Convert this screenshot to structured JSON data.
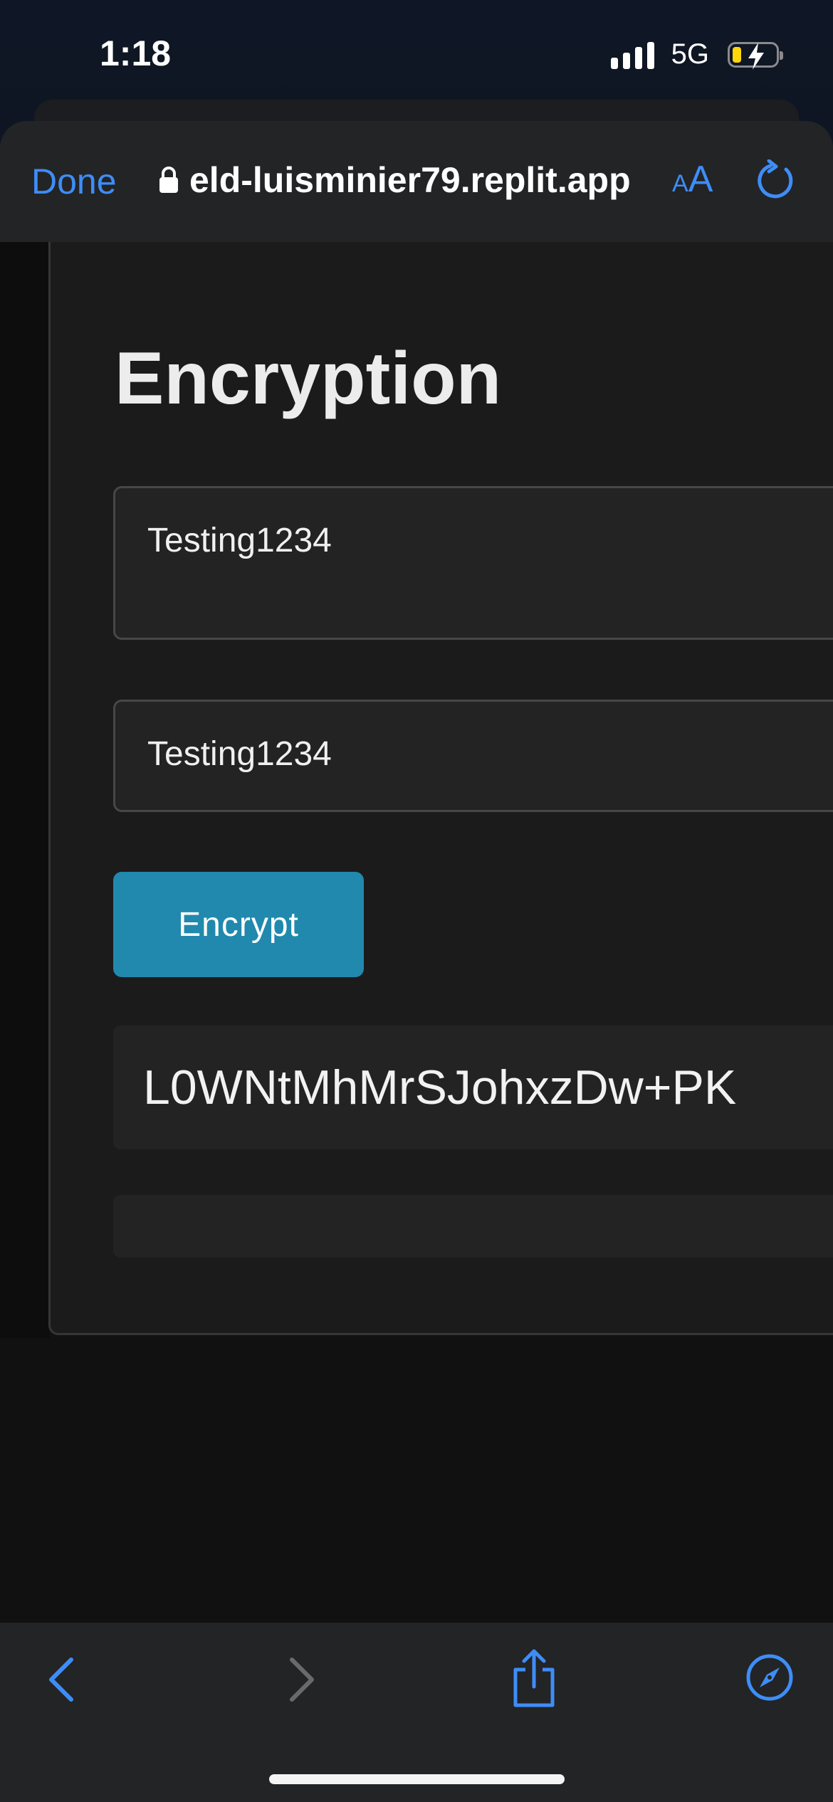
{
  "status_bar": {
    "time": "1:18",
    "network": "5G",
    "battery_level_percent": 20,
    "battery_charging": true
  },
  "safari": {
    "done_label": "Done",
    "url": "eld-luisminier79.replit.app",
    "text_size_small": "A",
    "text_size_large": "A",
    "accent_color": "#3e8df7"
  },
  "page": {
    "title": "Encryption",
    "input_1_value": "Testing1234",
    "input_2_value": "Testing1234",
    "encrypt_label": "Encrypt",
    "output_value": "L0WNtMhMrSJohxzDw+PK",
    "output_2_value": "",
    "button_color": "#2189ad"
  },
  "toolbar": {
    "icons": [
      "back-icon",
      "forward-icon",
      "share-icon",
      "compass-icon"
    ]
  }
}
